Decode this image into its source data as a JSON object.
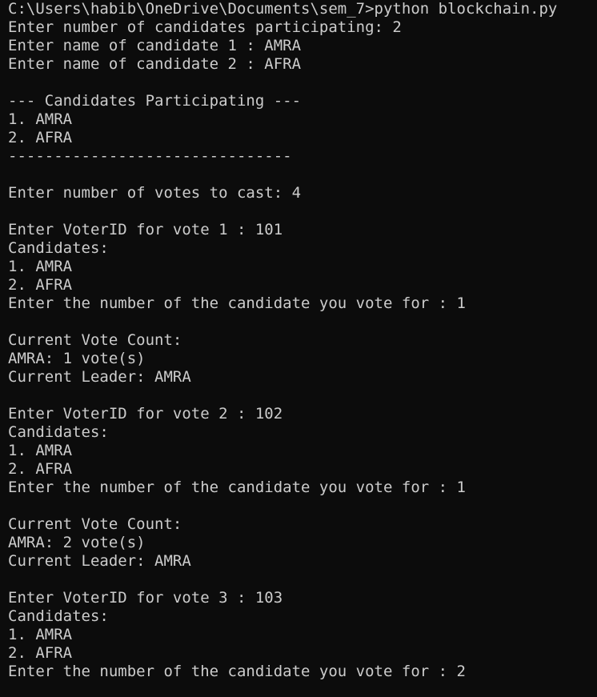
{
  "colors": {
    "background": "#0c0c0c",
    "foreground": "#cccccc"
  },
  "terminal": {
    "lines": [
      "C:\\Users\\habib\\OneDrive\\Documents\\sem_7>python blockchain.py",
      "Enter number of candidates participating: 2",
      "Enter name of candidate 1 : AMRA",
      "Enter name of candidate 2 : AFRA",
      "",
      "--- Candidates Participating ---",
      "1. AMRA",
      "2. AFRA",
      "-------------------------------",
      "",
      "Enter number of votes to cast: 4",
      "",
      "Enter VoterID for vote 1 : 101",
      "Candidates:",
      "1. AMRA",
      "2. AFRA",
      "Enter the number of the candidate you vote for : 1",
      "",
      "Current Vote Count:",
      "AMRA: 1 vote(s)",
      "Current Leader: AMRA",
      "",
      "Enter VoterID for vote 2 : 102",
      "Candidates:",
      "1. AMRA",
      "2. AFRA",
      "Enter the number of the candidate you vote for : 1",
      "",
      "Current Vote Count:",
      "AMRA: 2 vote(s)",
      "Current Leader: AMRA",
      "",
      "Enter VoterID for vote 3 : 103",
      "Candidates:",
      "1. AMRA",
      "2. AFRA",
      "Enter the number of the candidate you vote for : 2"
    ]
  }
}
